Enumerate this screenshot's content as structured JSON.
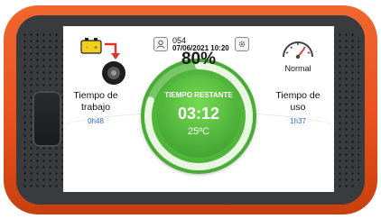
{
  "header": {
    "user_id": "054",
    "datetime": "07/06/2021 10:20"
  },
  "left_panel": {
    "label": "Tiempo de trabajo",
    "value": "0h48"
  },
  "right_panel": {
    "status": "Normal",
    "label": "Tiempo de uso",
    "value": "1h37"
  },
  "center": {
    "percent": "80%",
    "percent_value": 80,
    "remaining_label": "TIEMPO RESTANTE",
    "remaining_time": "03:12",
    "temperature": "25ºC"
  },
  "colors": {
    "shell": "#e8521d",
    "gauge": "#4fb53a",
    "value_text": "#2e6bd0"
  },
  "icons": {
    "user": "user-icon",
    "settings": "gear-icon",
    "battery_tire": "battery-charge-icon",
    "speedometer": "speedometer-icon"
  }
}
